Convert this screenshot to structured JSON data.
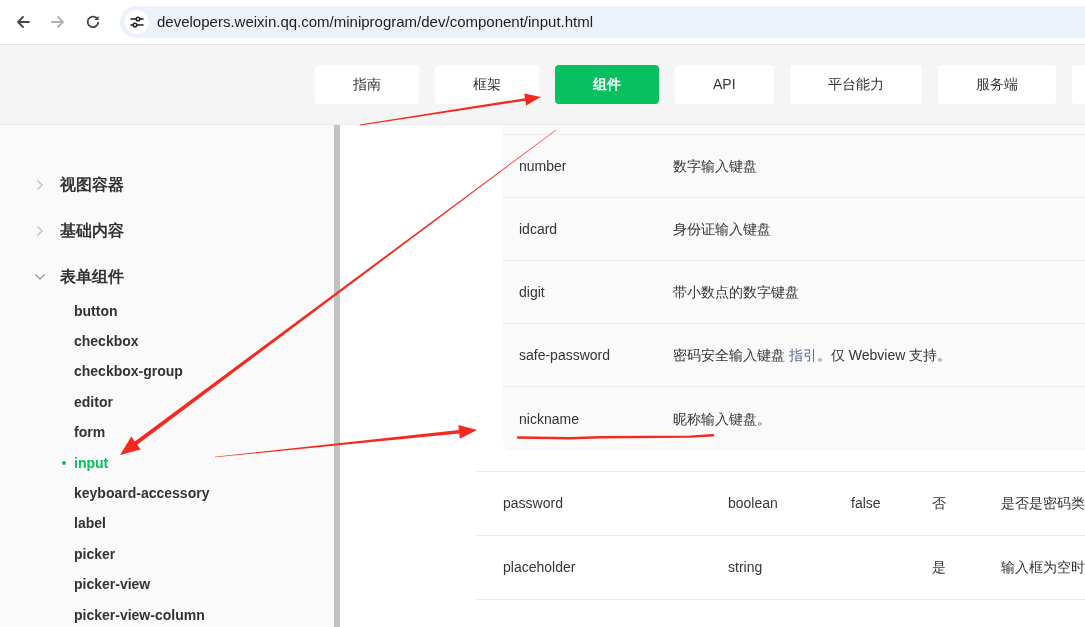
{
  "browser": {
    "controls": [
      {
        "kind": "back",
        "disabled": false
      },
      {
        "kind": "forward",
        "disabled": true
      },
      {
        "kind": "reload",
        "disabled": false
      }
    ],
    "url": "developers.weixin.qq.com/miniprogram/dev/component/input.html"
  },
  "nav": [
    {
      "label": "指南",
      "selected": false
    },
    {
      "label": "框架",
      "selected": false
    },
    {
      "label": "组件",
      "selected": true
    },
    {
      "label": "API",
      "selected": false
    },
    {
      "label": "平台能力",
      "selected": false
    },
    {
      "label": "服务端",
      "selected": false
    },
    {
      "selected": false
    }
  ],
  "sidebar": {
    "groups": [
      {
        "label": "视图容器",
        "expanded": false
      },
      {
        "label": "基础内容",
        "expanded": false
      },
      {
        "label": "表单组件",
        "expanded": true,
        "children": [
          {
            "label": "button",
            "selected": false
          },
          {
            "label": "checkbox",
            "selected": false
          },
          {
            "label": "checkbox-group",
            "selected": false
          },
          {
            "label": "editor",
            "selected": false
          },
          {
            "label": "form",
            "selected": false
          },
          {
            "label": "input",
            "selected": true
          },
          {
            "label": "keyboard-accessory",
            "selected": false
          },
          {
            "label": "label",
            "selected": false
          },
          {
            "label": "picker",
            "selected": false
          },
          {
            "label": "picker-view",
            "selected": false
          },
          {
            "label": "picker-view-column",
            "selected": false
          }
        ]
      }
    ]
  },
  "table": {
    "nested_rows": [
      {
        "column_1": "number",
        "column_2": [
          {
            "kind": "text",
            "text": "数字输入键盘"
          }
        ]
      },
      {
        "column_1": "idcard",
        "column_2": [
          {
            "kind": "text",
            "text": "身份证输入键盘"
          }
        ]
      },
      {
        "column_1": "digit",
        "column_2": [
          {
            "kind": "text",
            "text": "带小数点的数字键盘"
          }
        ]
      },
      {
        "column_1": "safe-password",
        "column_2": [
          {
            "kind": "text",
            "text": "密码安全输入键盘 "
          },
          {
            "kind": "link",
            "text": "指引"
          },
          {
            "kind": "text",
            "text": "。仅 Webview 支持。"
          }
        ]
      },
      {
        "column_1": "nickname",
        "column_2": [
          {
            "kind": "text",
            "text": "昵称输入键盘。"
          }
        ]
      }
    ],
    "rows": [
      {
        "column_1": "password",
        "column_2": "boolean",
        "column_3": "false",
        "column_4": "否",
        "column_5": "是否是密码类"
      },
      {
        "column_1": "placeholder",
        "column_2": "string",
        "column_4": "是",
        "column_5": "输入框为空时"
      }
    ]
  }
}
